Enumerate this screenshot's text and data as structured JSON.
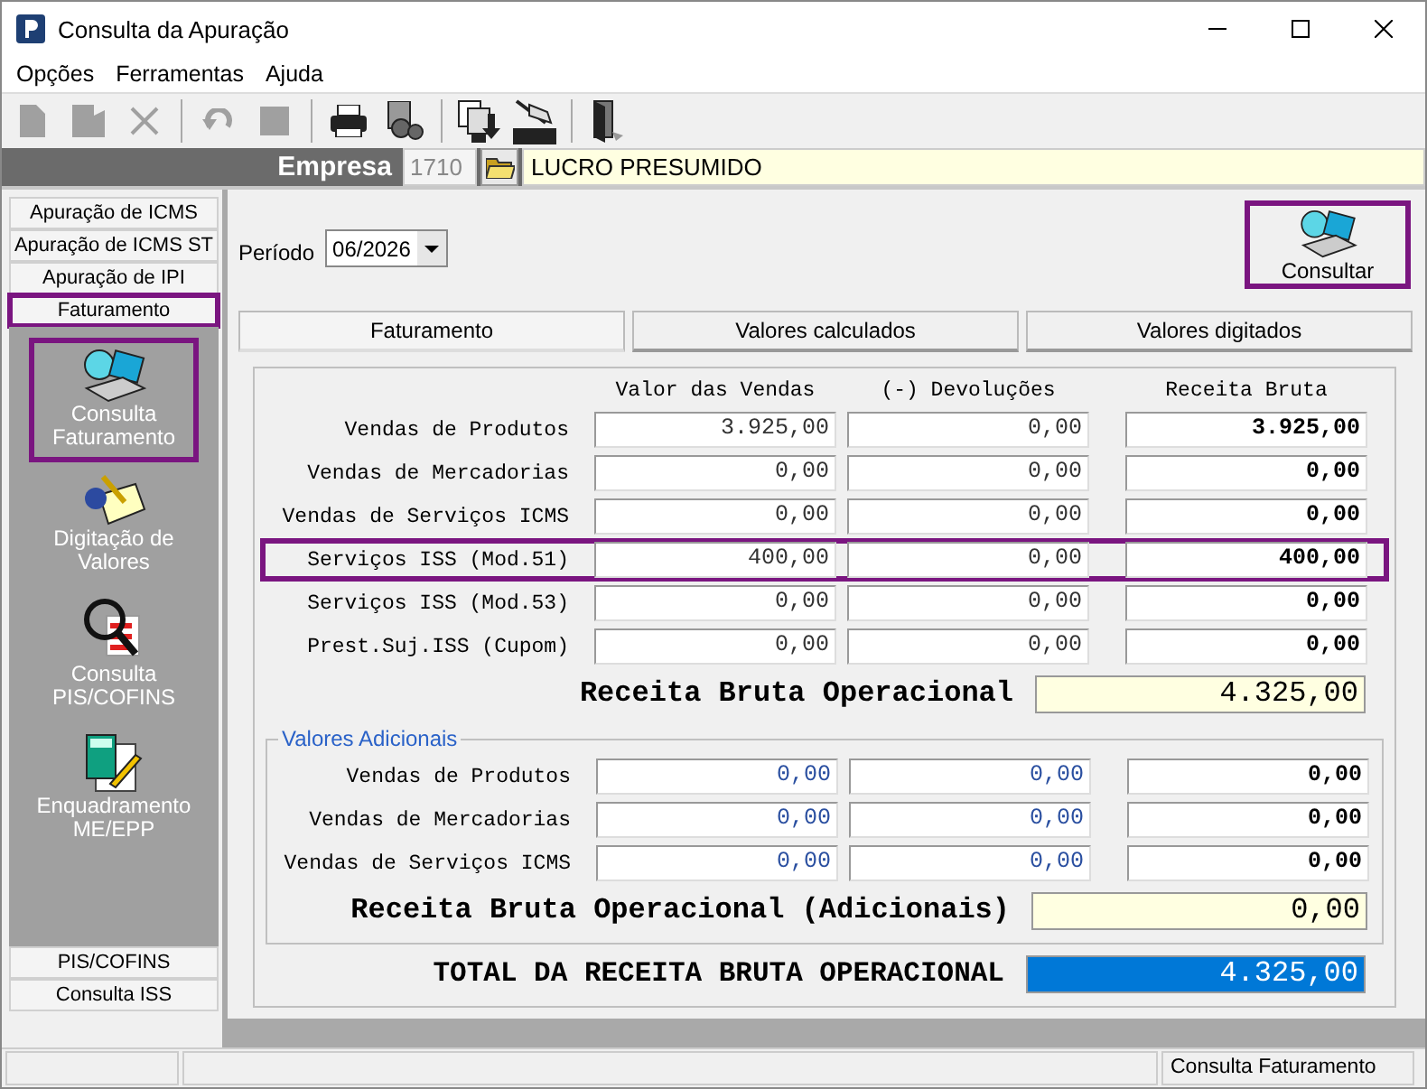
{
  "window": {
    "title": "Consulta da Apuração"
  },
  "menu": [
    "Opções",
    "Ferramentas",
    "Ajuda"
  ],
  "toolbar": [
    {
      "kind": "new",
      "disabled": true
    },
    {
      "kind": "edit",
      "disabled": true
    },
    {
      "kind": "delete",
      "disabled": true
    },
    {
      "kind": "sep"
    },
    {
      "kind": "undo",
      "disabled": true
    },
    {
      "kind": "stop",
      "disabled": true
    },
    {
      "kind": "sep"
    },
    {
      "kind": "print",
      "disabled": false
    },
    {
      "kind": "gears",
      "disabled": false
    },
    {
      "kind": "sep"
    },
    {
      "kind": "import",
      "disabled": false
    },
    {
      "kind": "antenna",
      "disabled": false
    },
    {
      "kind": "sep"
    },
    {
      "kind": "exit",
      "disabled": false
    }
  ],
  "empresa": {
    "label": "Empresa",
    "code": "1710",
    "name": "LUCRO PRESUMIDO"
  },
  "sidebar": {
    "top_tabs": [
      {
        "label": "Apuração de ICMS",
        "highlighted": false
      },
      {
        "label": "Apuração de ICMS ST",
        "highlighted": false
      },
      {
        "label": "Apuração de IPI",
        "highlighted": false
      },
      {
        "label": "Faturamento",
        "highlighted": true
      }
    ],
    "items": [
      {
        "kind": "laptop",
        "label": "Consulta Faturamento",
        "highlighted": true
      },
      {
        "kind": "notepad",
        "label": "Digitação de Valores",
        "highlighted": false
      },
      {
        "kind": "magnifier",
        "label": "Consulta PIS/COFINS",
        "highlighted": false
      },
      {
        "kind": "calculator",
        "label": "Enquadramento ME/EPP",
        "highlighted": false
      }
    ],
    "bottom_tabs": [
      {
        "label": "PIS/COFINS"
      },
      {
        "label": "Consulta ISS"
      }
    ]
  },
  "periodo": {
    "label": "Período",
    "value": "06/2026"
  },
  "consultar": {
    "label": "Consultar",
    "highlighted": true
  },
  "tabs": [
    {
      "label": "Faturamento",
      "selected": true
    },
    {
      "label": "Valores calculados",
      "selected": false
    },
    {
      "label": "Valores digitados",
      "selected": false
    }
  ],
  "table": {
    "columns": [
      "Valor das Vendas",
      "(-) Devoluções",
      "Receita Bruta"
    ],
    "rows": [
      {
        "label": "Vendas de Produtos",
        "values": [
          "3.925,00",
          "0,00",
          "3.925,00"
        ],
        "highlighted": false
      },
      {
        "label": "Vendas de Mercadorias",
        "values": [
          "0,00",
          "0,00",
          "0,00"
        ],
        "highlighted": false
      },
      {
        "label": "Vendas de Serviços ICMS",
        "values": [
          "0,00",
          "0,00",
          "0,00"
        ],
        "highlighted": false
      },
      {
        "label": "Serviços ISS (Mod.51)",
        "values": [
          "400,00",
          "0,00",
          "400,00"
        ],
        "highlighted": true
      },
      {
        "label": "Serviços ISS (Mod.53)",
        "values": [
          "0,00",
          "0,00",
          "0,00"
        ],
        "highlighted": false
      },
      {
        "label": "Prest.Suj.ISS (Cupom)",
        "values": [
          "0,00",
          "0,00",
          "0,00"
        ],
        "highlighted": false
      }
    ],
    "total": {
      "label": "Receita Bruta Operacional",
      "value": "4.325,00"
    }
  },
  "adicionais": {
    "title": "Valores Adicionais",
    "rows": [
      {
        "label": "Vendas de Produtos",
        "values": [
          "0,00",
          "0,00",
          "0,00"
        ],
        "highlighted": false
      },
      {
        "label": "Vendas de Mercadorias",
        "values": [
          "0,00",
          "0,00",
          "0,00"
        ],
        "highlighted": false
      },
      {
        "label": "Vendas de Serviços ICMS",
        "values": [
          "0,00",
          "0,00",
          "0,00"
        ],
        "highlighted": false
      }
    ],
    "total": {
      "label": "Receita Bruta Operacional (Adicionais)",
      "value": "0,00"
    }
  },
  "grand_total": {
    "label": "TOTAL DA RECEITA BRUTA OPERACIONAL",
    "value": "4.325,00"
  },
  "status_bar": {
    "panel": "Consulta Faturamento"
  }
}
